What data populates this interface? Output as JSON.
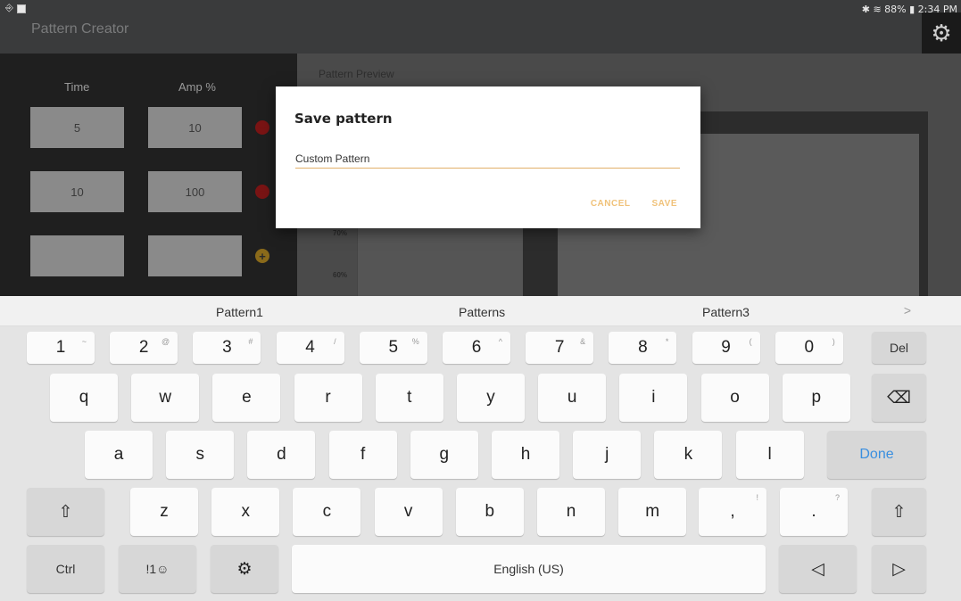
{
  "status_bar": {
    "left_icons": [
      "nfc-icon",
      "image-icon"
    ],
    "right_text": "✱ ☰ 88% ▣ 2:34 PM",
    "bluetooth": "✱",
    "battery": "88%",
    "time": "2:34 PM"
  },
  "app": {
    "title": "Pattern Creator",
    "settings_icon": "gear-icon"
  },
  "pattern_table": {
    "col_time": "Time",
    "col_amp": "Amp %",
    "rows": [
      {
        "time": "5",
        "amp": "10",
        "action": "remove"
      },
      {
        "time": "10",
        "amp": "100",
        "action": "remove"
      },
      {
        "time": "",
        "amp": "",
        "action": "add"
      }
    ]
  },
  "preview": {
    "title": "Pattern Preview",
    "y_labels": [
      "70%",
      "60%"
    ]
  },
  "dialog": {
    "title": "Save pattern",
    "input_value": "Custom Pattern",
    "cancel_label": "CANCEL",
    "save_label": "SAVE",
    "accent_color": "#f0c27a"
  },
  "suggestions": {
    "items": [
      "Pattern1",
      "Patterns",
      "Pattern3"
    ],
    "more": ">"
  },
  "keyboard": {
    "row1": [
      {
        "k": "1",
        "h": "~"
      },
      {
        "k": "2",
        "h": "@"
      },
      {
        "k": "3",
        "h": "#"
      },
      {
        "k": "4",
        "h": "/"
      },
      {
        "k": "5",
        "h": "%"
      },
      {
        "k": "6",
        "h": "^"
      },
      {
        "k": "7",
        "h": "&"
      },
      {
        "k": "8",
        "h": "*"
      },
      {
        "k": "9",
        "h": "("
      },
      {
        "k": "0",
        "h": ")"
      }
    ],
    "del": "Del",
    "row2": [
      "q",
      "w",
      "e",
      "r",
      "t",
      "y",
      "u",
      "i",
      "o",
      "p"
    ],
    "row3": [
      "a",
      "s",
      "d",
      "f",
      "g",
      "h",
      "j",
      "k",
      "l"
    ],
    "done": "Done",
    "row4": [
      "z",
      "x",
      "c",
      "v",
      "b",
      "n",
      "m"
    ],
    "comma": ",",
    "comma_hint": "!",
    "period": ".",
    "period_hint": "?",
    "ctrl": "Ctrl",
    "symbols": "!1☺",
    "space": "English (US)",
    "left_arrow": "◁",
    "right_arrow": "▷",
    "shift": "⇧",
    "backspace": "⌫"
  }
}
